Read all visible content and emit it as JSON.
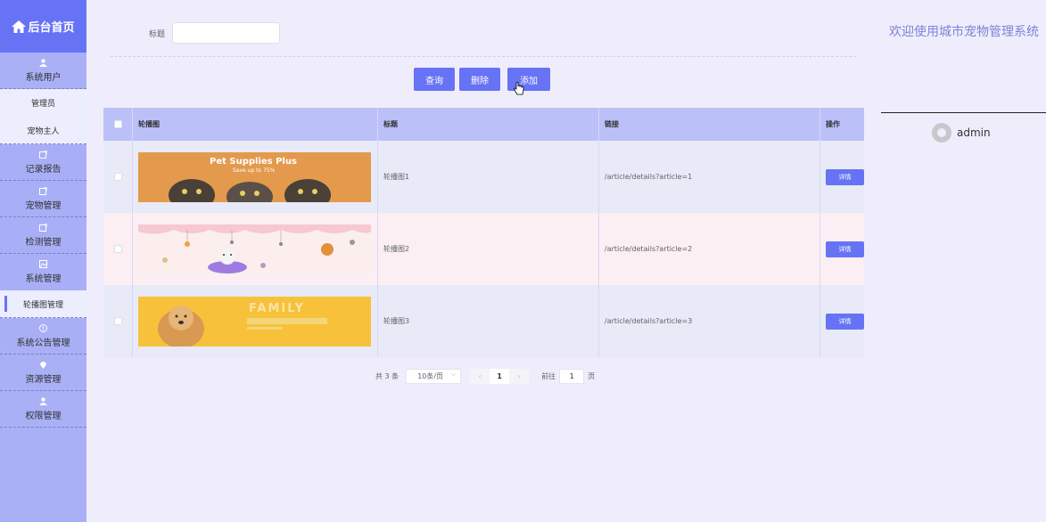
{
  "sidebar": {
    "brand": "后台首页",
    "menu": {
      "system_user": "系统用户",
      "sub_admin": "管理员",
      "sub_owner": "宠物主人",
      "record": "记录报告",
      "pet": "宠物管理",
      "detect": "检测管理",
      "system": "系统管理",
      "sub_carousel": "轮播图管理",
      "notice": "系统公告管理",
      "resource": "资源管理",
      "permission": "权限管理"
    }
  },
  "search": {
    "label": "标题",
    "value": ""
  },
  "toolbar": {
    "query": "查询",
    "delete": "删除",
    "add": "添加"
  },
  "header": {
    "welcome": "欢迎使用城市宠物管理系统",
    "user": "admin"
  },
  "table": {
    "columns": [
      "轮播图",
      "标题",
      "链接",
      "操作"
    ],
    "rows": [
      {
        "title": "轮播图1",
        "link": "/article/details?article=1",
        "action": "详情",
        "banner_text": "Pet Supplies Plus",
        "banner_sub": "Save up to 75%"
      },
      {
        "title": "轮播图2",
        "link": "/article/details?article=2",
        "action": "详情"
      },
      {
        "title": "轮播图3",
        "link": "/article/details?article=3",
        "action": "详情",
        "banner_text": "FAMILY"
      }
    ]
  },
  "pager": {
    "total": "共 3 条",
    "size": "10条/页",
    "page": "1",
    "goto": "前往",
    "goto_value": "1",
    "page_unit": "页"
  },
  "colors": {
    "accent": "#6773f5",
    "sidebar": "#a8aef6",
    "header_row": "#bcc0f8"
  }
}
